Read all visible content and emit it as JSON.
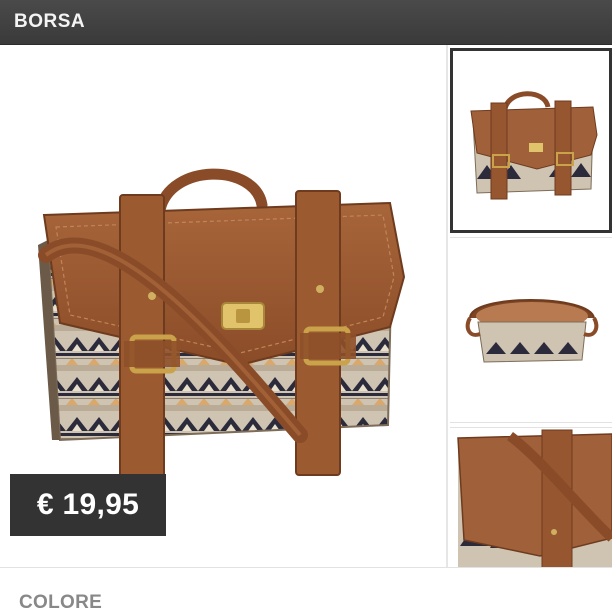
{
  "header": {
    "title": "BORSA"
  },
  "product": {
    "price": "€ 19,95",
    "color_label": "COLORE"
  },
  "thumbnails": [
    {
      "name": "thumbnail-front-view",
      "selected": true
    },
    {
      "name": "thumbnail-open-view",
      "selected": false
    },
    {
      "name": "thumbnail-detail-view",
      "selected": false
    }
  ],
  "colors": {
    "header_bg": "#3f3f3f",
    "price_bg": "#333333",
    "leather": "#9a5a34",
    "text_muted": "#888888"
  }
}
